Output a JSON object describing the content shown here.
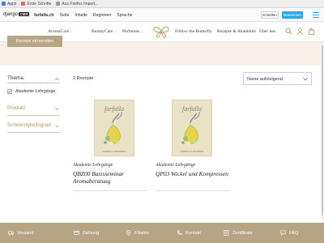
{
  "bookmarks": {
    "items": [
      {
        "label": "Apps",
        "color": "#4a7fd6"
      },
      {
        "label": "Erste Schritte",
        "color": "#e2743c"
      },
      {
        "label": "Aus Firefox Import...",
        "color": "#999999"
      }
    ]
  },
  "cms_toolbar": {
    "logo_text": "django",
    "logo_tag": "CMS",
    "menu": [
      "farfalla.ch",
      "Seite",
      "Inhalte",
      "Regionen",
      "Sprache"
    ],
    "create_label": "Erstellen",
    "edit_label": "Bearbeiten",
    "accent": "#2ba6e8"
  },
  "site_nav": {
    "left_items": [
      {
        "label": "AromaCare"
      },
      {
        "label": "BeautyCare"
      },
      {
        "label": "Perfumes"
      }
    ],
    "right_items": [
      {
        "label": "Follow the Butterfly"
      },
      {
        "label": "Rezepte & Akademie"
      },
      {
        "label": "Über uns"
      }
    ],
    "icons": [
      "search-icon",
      "user-icon",
      "cart-icon"
    ],
    "brand_color": "#b39760"
  },
  "hero": {
    "button_label": "Rezept einsenden",
    "background": "#f7f1ea"
  },
  "filters": {
    "sections": [
      {
        "title": "Thema"
      },
      {
        "title": "Produkt"
      },
      {
        "title": "Schwierigkeitsgrad"
      }
    ],
    "options": [
      {
        "label": "Akademie Lehrgänge",
        "checked": true
      }
    ]
  },
  "listing": {
    "count_label": "2 Rezepte",
    "sort_label": "Name aufsteigend",
    "cards": [
      {
        "brand": "farfalla",
        "image_caption": "FARFALLA AROMATH",
        "category": "Akademie Lehrgänge",
        "title": "QBZ00 Basisseminar Aromaberatung"
      },
      {
        "brand": "farfalla",
        "image_caption": "FARFALLA AROMATH",
        "category": "Akademie Lehrgänge",
        "title": "QP03 Wickel und Kompressen"
      }
    ]
  },
  "footer": {
    "background": "#b7a585",
    "items": [
      {
        "label": "Versand",
        "icon": "shipping-icon"
      },
      {
        "label": "Zahlung",
        "icon": "payment-icon"
      },
      {
        "label": "Filialen",
        "icon": "location-icon"
      },
      {
        "label": "Kontakt",
        "icon": "phone-icon"
      },
      {
        "label": "Zertifikate",
        "icon": "certificate-icon"
      },
      {
        "label": "FAQ",
        "icon": "chat-icon"
      }
    ]
  }
}
